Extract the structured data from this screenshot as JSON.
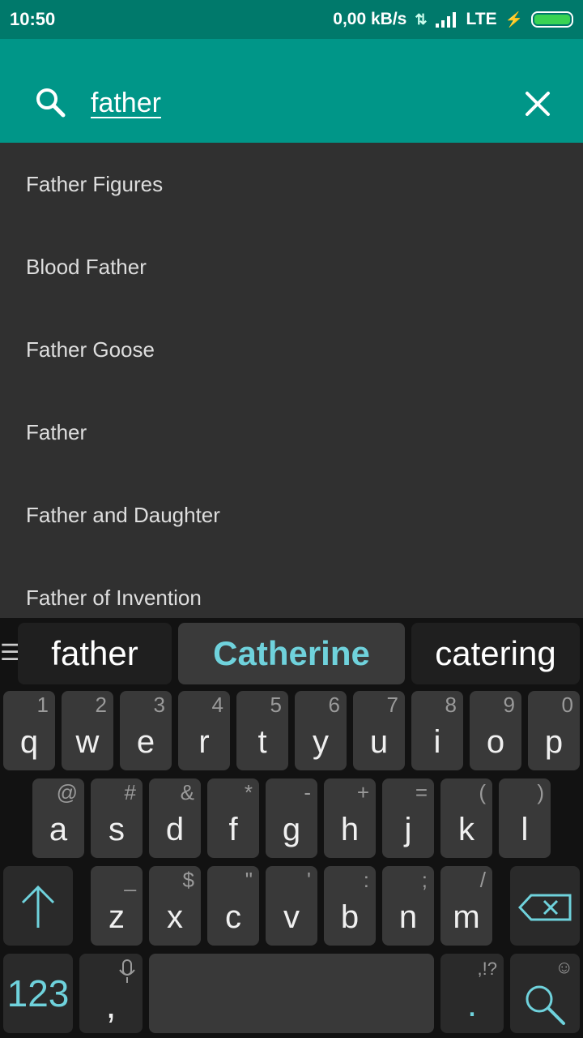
{
  "status": {
    "time": "10:50",
    "network_speed": "0,00 kB/s",
    "network_type": "LTE",
    "battery_color": "#39d353"
  },
  "search": {
    "query": "father",
    "icons": [
      "search-icon",
      "close-icon"
    ]
  },
  "suggestions": [
    "Father Figures",
    "Blood Father",
    "Father Goose",
    "Father",
    "Father and Daughter",
    "Father of Invention"
  ],
  "keyboard": {
    "candidates": [
      "father",
      "Catherine",
      "catering"
    ],
    "rows": [
      [
        [
          "q",
          "1"
        ],
        [
          "w",
          "2"
        ],
        [
          "e",
          "3"
        ],
        [
          "r",
          "4"
        ],
        [
          "t",
          "5"
        ],
        [
          "y",
          "6"
        ],
        [
          "u",
          "7"
        ],
        [
          "i",
          "8"
        ],
        [
          "o",
          "9"
        ],
        [
          "p",
          "0"
        ]
      ],
      [
        [
          "a",
          "@"
        ],
        [
          "s",
          "#"
        ],
        [
          "d",
          "&"
        ],
        [
          "f",
          "*"
        ],
        [
          "g",
          "-"
        ],
        [
          "h",
          "+"
        ],
        [
          "j",
          "="
        ],
        [
          "k",
          "("
        ],
        [
          "l",
          ")"
        ]
      ],
      [
        [
          "z",
          "_"
        ],
        [
          "x",
          "$"
        ],
        [
          "c",
          "\""
        ],
        [
          "v",
          "'"
        ],
        [
          "b",
          ":"
        ],
        [
          "n",
          ";"
        ],
        [
          "m",
          "/"
        ]
      ]
    ],
    "numbers_label": "123",
    "comma_label": ",",
    "period_label": ".",
    "period_hint": ",!?",
    "accent_color": "#6fd2dc"
  },
  "colors": {
    "appbar": "#009688",
    "statusbar": "#00796b",
    "background": "#303030"
  }
}
